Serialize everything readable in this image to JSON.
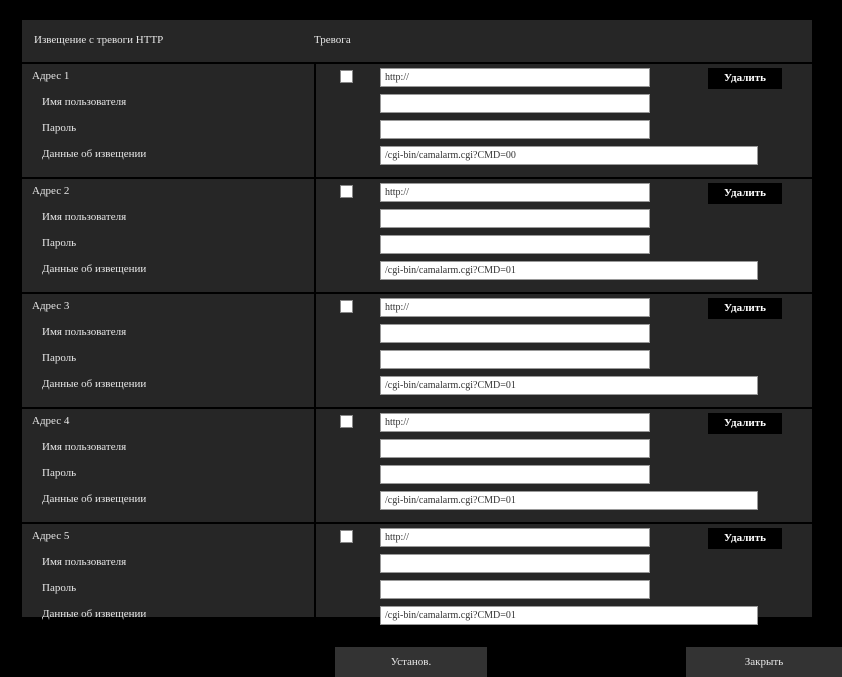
{
  "header": {
    "title": "Извещение с тревоги HTTP",
    "trigger_label": "Тревога"
  },
  "blocks": [
    {
      "addr_label": "Адрес 1",
      "user_label": "Имя пользователя",
      "pass_label": "Пароль",
      "data_label": "Данные об извещении",
      "checked": false,
      "url_value": "http://",
      "user_value": "",
      "pass_value": "",
      "cmd_value": "/cgi-bin/camalarm.cgi?CMD=00",
      "delete_label": "Удалить"
    },
    {
      "addr_label": "Адрес 2",
      "user_label": "Имя пользователя",
      "pass_label": "Пароль",
      "data_label": "Данные об извещении",
      "checked": false,
      "url_value": "http://",
      "user_value": "",
      "pass_value": "",
      "cmd_value": "/cgi-bin/camalarm.cgi?CMD=01",
      "delete_label": "Удалить"
    },
    {
      "addr_label": "Адрес 3",
      "user_label": "Имя пользователя",
      "pass_label": "Пароль",
      "data_label": "Данные об извещении",
      "checked": false,
      "url_value": "http://",
      "user_value": "",
      "pass_value": "",
      "cmd_value": "/cgi-bin/camalarm.cgi?CMD=01",
      "delete_label": "Удалить"
    },
    {
      "addr_label": "Адрес 4",
      "user_label": "Имя пользователя",
      "pass_label": "Пароль",
      "data_label": "Данные об извещении",
      "checked": false,
      "url_value": "http://",
      "user_value": "",
      "pass_value": "",
      "cmd_value": "/cgi-bin/camalarm.cgi?CMD=01",
      "delete_label": "Удалить"
    },
    {
      "addr_label": "Адрес 5",
      "user_label": "Имя пользователя",
      "pass_label": "Пароль",
      "data_label": "Данные об извещении",
      "checked": false,
      "url_value": "http://",
      "user_value": "",
      "pass_value": "",
      "cmd_value": "/cgi-bin/camalarm.cgi?CMD=01",
      "delete_label": "Удалить"
    }
  ],
  "footer": {
    "set_label": "Установ.",
    "close_label": "Закрыть"
  }
}
